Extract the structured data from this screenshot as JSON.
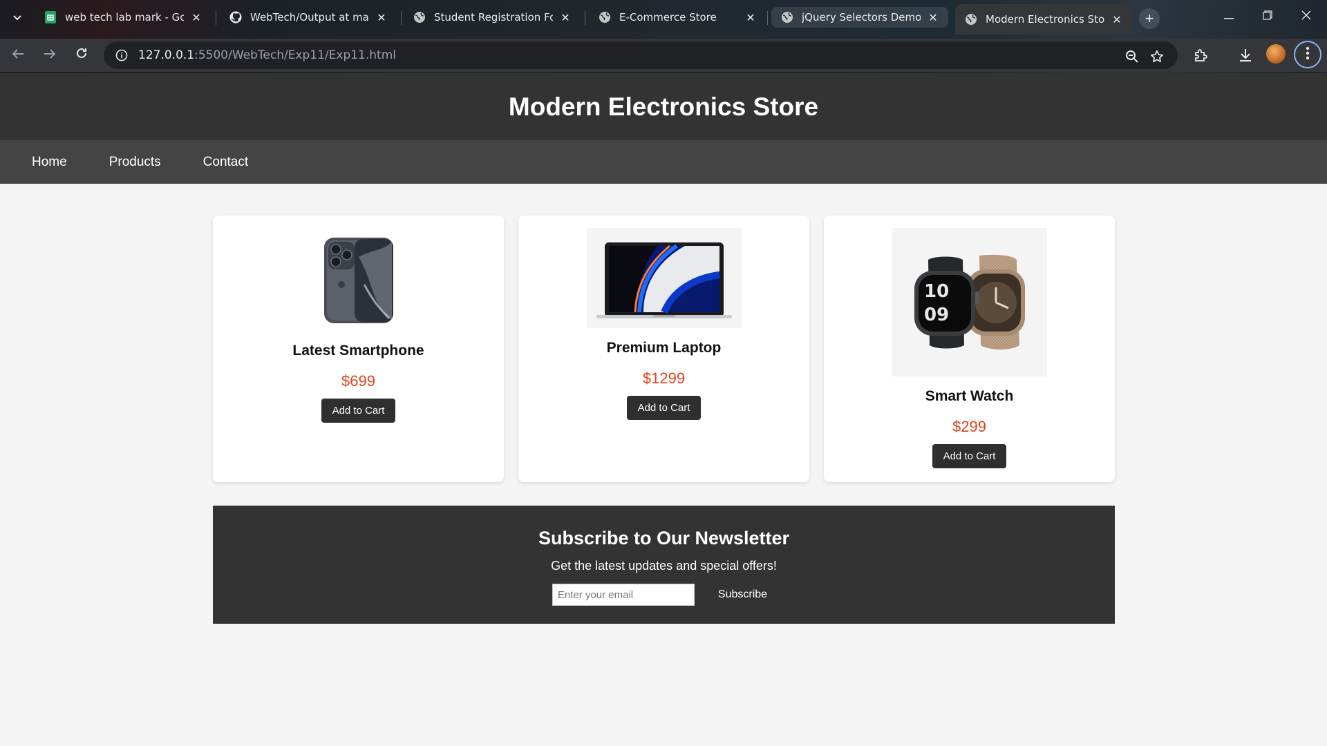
{
  "browser": {
    "tabs": [
      {
        "title": "web tech lab mark - Googl",
        "favicon": "google-sheets-icon",
        "active": false
      },
      {
        "title": "WebTech/Output at main ·",
        "favicon": "github-icon",
        "active": false
      },
      {
        "title": "Student Registration Form",
        "favicon": "globe-icon",
        "active": false
      },
      {
        "title": "E-Commerce Store",
        "favicon": "globe-icon",
        "active": false
      },
      {
        "title": "jQuery Selectors Demo - Ti",
        "favicon": "globe-icon",
        "active": false
      },
      {
        "title": "Modern Electronics Store",
        "favicon": "globe-icon",
        "active": true
      }
    ],
    "url_host": "127.0.0.1",
    "url_path": ":5500/WebTech/Exp11/Exp11.html"
  },
  "site": {
    "title": "Modern Electronics Store",
    "nav": [
      "Home",
      "Products",
      "Contact"
    ]
  },
  "products": [
    {
      "name": "Latest Smartphone",
      "price": "$699",
      "button": "Add to Cart",
      "image": "smartphone-image"
    },
    {
      "name": "Premium Laptop",
      "price": "$1299",
      "button": "Add to Cart",
      "image": "laptop-image"
    },
    {
      "name": "Smart Watch",
      "price": "$299",
      "button": "Add to Cart",
      "image": "smartwatch-image"
    }
  ],
  "newsletter": {
    "heading": "Subscribe to Our Newsletter",
    "text": "Get the latest updates and special offers!",
    "placeholder": "Enter your email",
    "button": "Subscribe"
  },
  "colors": {
    "header_bg": "#333333",
    "nav_bg": "#444444",
    "price": "#e0431f",
    "page_bg": "#f4f4f4"
  }
}
